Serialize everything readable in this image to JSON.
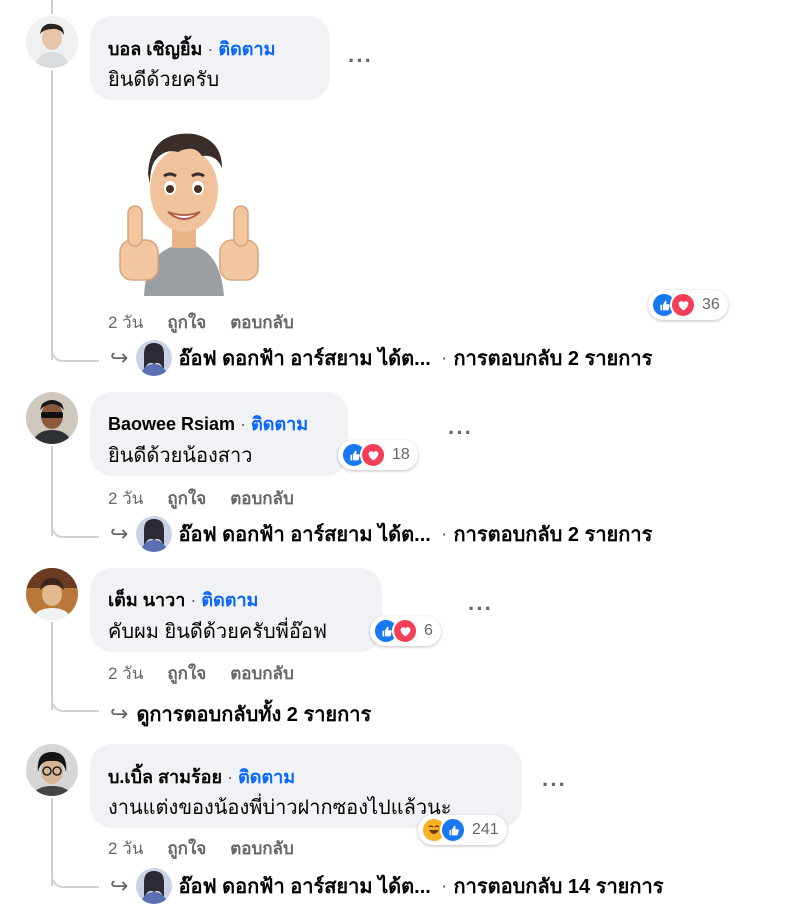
{
  "labels": {
    "follow": "ติดตาม",
    "like": "ถูกใจ",
    "reply": "ตอบกลับ",
    "more": "···",
    "dot": "·"
  },
  "colors": {
    "link_blue": "#0866ff",
    "bubble_bg": "#f0f2f5",
    "secondary_text": "#65676b",
    "like_blue": "#1877f2",
    "love_red": "#f33e58"
  },
  "comments": [
    {
      "author": "บอล เชิญยิ้ม",
      "text": "ยินดีด้วยครับ",
      "time": "2 วัน",
      "sticker": "thumbs-up-avatar-sticker",
      "reactions": {
        "icons": [
          "like-icon",
          "love-icon"
        ],
        "count": "36"
      },
      "replies": {
        "replier": "อ๊อฟ ดอกฟ้า อาร์สยาม ได้ต...",
        "summary": "การตอบกลับ 2 รายการ"
      }
    },
    {
      "author": "Baowee Rsiam",
      "text": "ยินดีด้วยน้องสาว",
      "time": "2 วัน",
      "reactions": {
        "icons": [
          "like-icon",
          "love-icon"
        ],
        "count": "18"
      },
      "replies": {
        "replier": "อ๊อฟ ดอกฟ้า อาร์สยาม ได้ต...",
        "summary": "การตอบกลับ 2 รายการ"
      }
    },
    {
      "author": "เต็ม นาวา",
      "text": "คับผม ยินดีด้วยครับพี่อ๊อฟ",
      "time": "2 วัน",
      "reactions": {
        "icons": [
          "like-icon",
          "love-icon"
        ],
        "count": "6"
      },
      "replies": {
        "view_all": "ดูการตอบกลับทั้ง 2 รายการ"
      }
    },
    {
      "author": "บ.เบิ้ล สามร้อย",
      "text": "งานแต่งของน้องพี่บ่าวฝากซองไปแล้วนะ",
      "time": "2 วัน",
      "reactions": {
        "icons": [
          "haha-icon",
          "like-icon"
        ],
        "count": "241"
      },
      "replies": {
        "replier": "อ๊อฟ ดอกฟ้า อาร์สยาม ได้ต...",
        "summary": "การตอบกลับ 14 รายการ"
      }
    }
  ]
}
